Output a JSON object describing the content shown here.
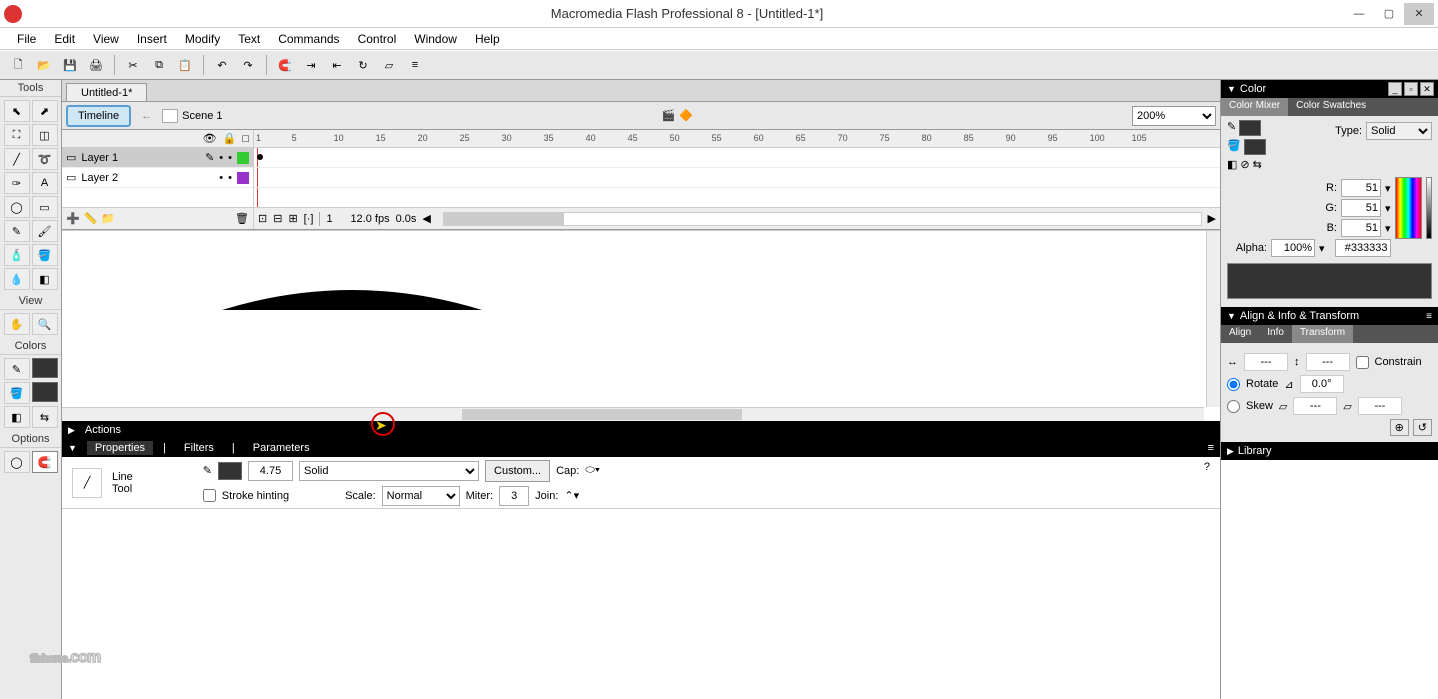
{
  "title": "Macromedia Flash Professional 8 - [Untitled-1*]",
  "menus": [
    "File",
    "Edit",
    "View",
    "Insert",
    "Modify",
    "Text",
    "Commands",
    "Control",
    "Window",
    "Help"
  ],
  "toolbar_icons": [
    "new",
    "open",
    "save",
    "print",
    "|",
    "cut",
    "copy",
    "paste",
    "|",
    "undo",
    "redo",
    "|",
    "magnet",
    "snap-obj",
    "snap-align",
    "rotate",
    "skew",
    "align"
  ],
  "tools_panel": {
    "title": "Tools",
    "tools": [
      "selection",
      "subselection",
      "free-transform",
      "gradient-transform",
      "line",
      "lasso",
      "pen",
      "text",
      "oval",
      "rectangle",
      "pencil",
      "brush",
      "ink-bottle",
      "paint-bucket",
      "eyedropper",
      "eraser"
    ],
    "view_title": "View",
    "view_tools": [
      "hand",
      "zoom"
    ],
    "colors_title": "Colors",
    "options_title": "Options"
  },
  "document": {
    "tab": "Untitled-1*",
    "timeline_btn": "Timeline",
    "scene": "Scene 1",
    "zoom": "200%"
  },
  "timeline": {
    "layers": [
      {
        "name": "Layer 1",
        "color": "#3c3",
        "active": true
      },
      {
        "name": "Layer 2",
        "color": "#93c",
        "active": false
      }
    ],
    "ruler_marks": [
      "1",
      "5",
      "10",
      "15",
      "20",
      "25",
      "30",
      "35",
      "40",
      "45",
      "50",
      "55",
      "60",
      "65",
      "70",
      "75",
      "80",
      "85",
      "90",
      "95",
      "100",
      "105"
    ],
    "status": {
      "frame": "1",
      "fps": "12.0 fps",
      "time": "0.0s"
    }
  },
  "actions": {
    "title": "Actions"
  },
  "properties": {
    "tabs": [
      "Properties",
      "Filters",
      "Parameters"
    ],
    "tool_label_1": "Line",
    "tool_label_2": "Tool",
    "stroke_width": "4.75",
    "style": "Solid",
    "custom_btn": "Custom...",
    "cap_label": "Cap:",
    "stroke_hinting_label": "Stroke hinting",
    "scale_label": "Scale:",
    "scale_value": "Normal",
    "miter_label": "Miter:",
    "miter_value": "3",
    "join_label": "Join:"
  },
  "color_panel": {
    "title": "Color",
    "tabs": [
      "Color Mixer",
      "Color Swatches"
    ],
    "type_label": "Type:",
    "type_value": "Solid",
    "r_label": "R:",
    "r_value": "51",
    "g_label": "G:",
    "g_value": "51",
    "b_label": "B:",
    "b_value": "51",
    "alpha_label": "Alpha:",
    "alpha_value": "100%",
    "hex": "#333333"
  },
  "align_panel": {
    "title": "Align & Info & Transform",
    "tabs": [
      "Align",
      "Info",
      "Transform"
    ],
    "width": "---",
    "height": "---",
    "constrain_label": "Constrain",
    "rotate_label": "Rotate",
    "rotate_value": "0.0°",
    "skew_label": "Skew",
    "skew_h": "---",
    "skew_v": "---"
  },
  "library_panel": {
    "title": "Library"
  },
  "watermark": "filehorse",
  "watermark_suffix": ".com"
}
